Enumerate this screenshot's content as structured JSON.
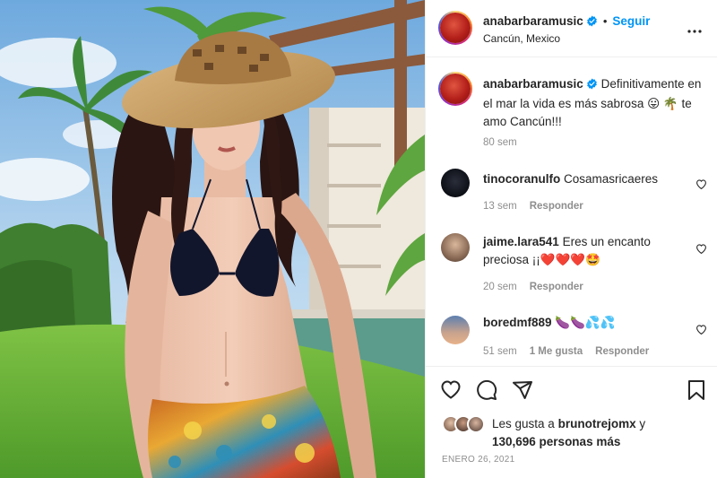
{
  "header": {
    "username": "anabarbaramusic",
    "separator": "•",
    "follow_label": "Seguir",
    "location": "Cancún, Mexico"
  },
  "caption": {
    "username": "anabarbaramusic",
    "text": "Definitivamente en el mar la vida es más sabrosa 😛 🌴 te amo Cancún!!!",
    "time": "80 sem"
  },
  "comments": [
    {
      "username": "tinocoranulfo",
      "text": "Cosamasricaeres",
      "time": "13 sem",
      "likes": "",
      "reply_label": "Responder"
    },
    {
      "username": "jaime.lara541",
      "text": "Eres un encanto preciosa ¡¡❤️❤️❤️🤩",
      "time": "20 sem",
      "likes": "",
      "reply_label": "Responder"
    },
    {
      "username": "boredmf889",
      "text": "🍆🍆💦💦",
      "time": "51 sem",
      "likes": "1 Me gusta",
      "reply_label": "Responder"
    }
  ],
  "likes": {
    "prefix": "Les gusta a",
    "user": "brunotrejomx",
    "connector": "y",
    "count_text": "130,696 personas más"
  },
  "post_date": "ENERO 26, 2021",
  "icons": {
    "verified": "verified-badge-icon",
    "more": "more-options-icon",
    "like": "heart-icon",
    "comment": "comment-icon",
    "share": "share-icon",
    "save": "bookmark-icon"
  },
  "colors": {
    "accent": "#0095f6",
    "text": "#262626",
    "muted": "#8e8e8e",
    "border": "#efefef"
  }
}
